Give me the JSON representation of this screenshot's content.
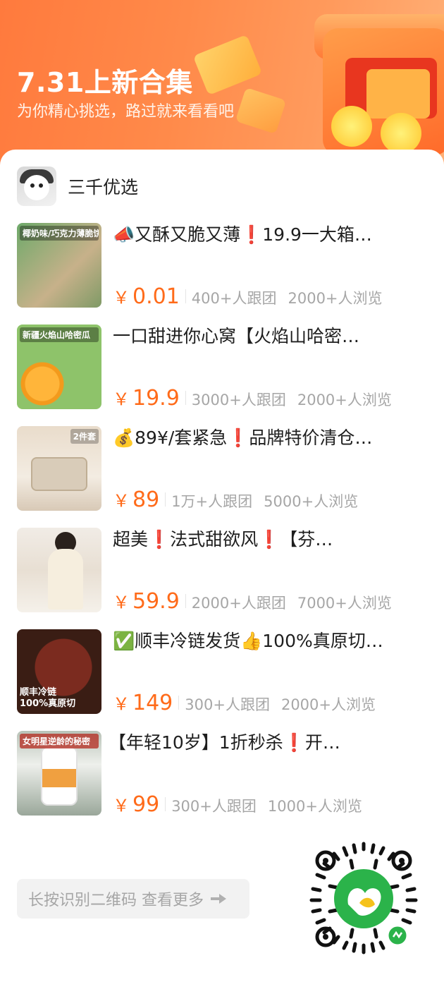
{
  "header": {
    "title": "7.31上新合集",
    "subtitle": "为你精心挑选，路过就来看看吧",
    "accent_color": "#ff7a3d"
  },
  "shop": {
    "name": "三千优选"
  },
  "products": [
    {
      "title": "📣又酥又脆又薄❗️19.9一大箱…",
      "thumb_tag": "椰奶味/巧克力薄脆饼干",
      "thumb_badge": "",
      "currency": "￥",
      "price": "0.01",
      "groups": "400+人跟团",
      "views": "2000+人浏览"
    },
    {
      "title": "一口甜进你心窝【火焰山哈密…",
      "thumb_tag": "新疆火焰山哈密瓜",
      "thumb_badge": "",
      "currency": "￥",
      "price": "19.9",
      "groups": "3000+人跟团",
      "views": "2000+人浏览"
    },
    {
      "title": "💰89¥/套紧急❗️品牌特价清仓…",
      "thumb_tag": "2件套",
      "thumb_badge": "",
      "currency": "￥",
      "price": "89",
      "groups": "1万+人跟团",
      "views": "5000+人浏览"
    },
    {
      "title": "超美❗️法式甜欲风❗️【芬…",
      "thumb_tag": "",
      "thumb_badge": "",
      "currency": "￥",
      "price": "59.9",
      "groups": "2000+人跟团",
      "views": "7000+人浏览"
    },
    {
      "title": "✅顺丰冷链发货👍100%真原切…",
      "thumb_tag": "",
      "thumb_badge": "顺丰冷链 100%真原切",
      "currency": "￥",
      "price": "149",
      "groups": "300+人跟团",
      "views": "2000+人浏览"
    },
    {
      "title": "【年轻10岁】1折秒杀❗️开…",
      "thumb_tag": "女明星逆龄的秘密",
      "thumb_badge": "",
      "currency": "￥",
      "price": "99",
      "groups": "300+人跟团",
      "views": "1000+人浏览"
    }
  ],
  "footer": {
    "longpress_text": "长按识别二维码 查看更多",
    "arrow_icon": "hand-point-right-icon",
    "qr_icon": "mini-program-qr-code"
  },
  "colors": {
    "price": "#ff6b1a",
    "meta": "#a6a6a6",
    "qr_green": "#2bb34a"
  }
}
